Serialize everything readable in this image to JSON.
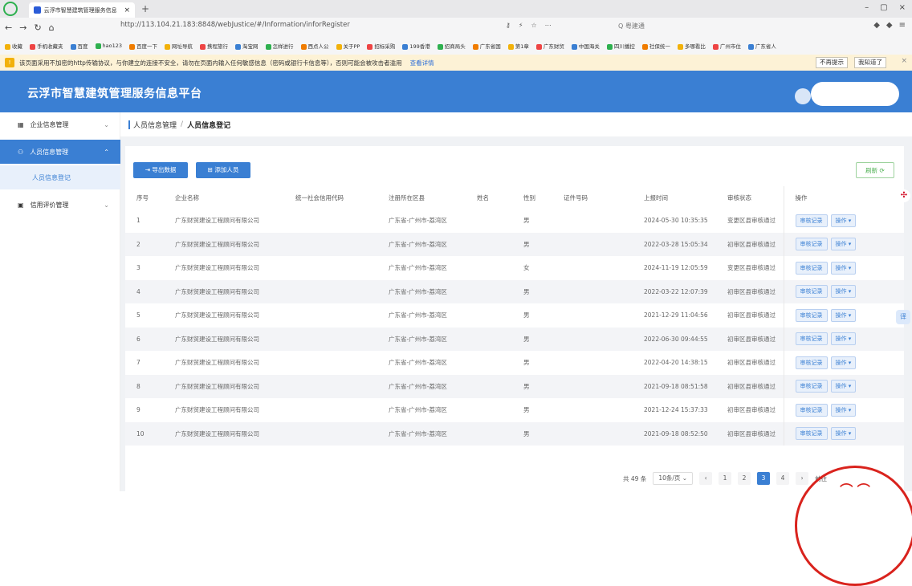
{
  "browser": {
    "tab_title": "云浮市智慧建筑管理服务信息",
    "url": "http://113.104.21.183:8848/webJustice/#/Information/inforRegister",
    "search_placeholder": "Q 粤建通",
    "bookmarks": [
      "收藏",
      "手机收藏夹",
      "百度",
      "hao123",
      "百度一下",
      "网址导航",
      "携程旅行",
      "淘宝网",
      "怎样进行",
      "西点人公",
      "关于PP",
      "招标采购",
      "199香港",
      "招商局头",
      "广东省国",
      "第1章",
      "广东财贸",
      "中国海关",
      "四川播控",
      "社保统一",
      "多哪看比",
      "广州市住",
      "广东省人"
    ]
  },
  "warning": {
    "text": "该页面采用不加密的http传输协议，与你建立的连接不安全，请勿在页面内输入任何敏感信息（密码或银行卡信息等），否则可能会被攻击者滥用",
    "link": "查看详情",
    "btn_no_remind": "不再提示",
    "btn_ok": "我知道了"
  },
  "header": {
    "title": "云浮市智慧建筑管理服务信息平台"
  },
  "sidebar": {
    "items": [
      {
        "label": "企业信息管理"
      },
      {
        "label": "人员信息管理"
      },
      {
        "label": "人员信息登记"
      },
      {
        "label": "信用评价管理"
      }
    ]
  },
  "breadcrumb": {
    "parent": "人员信息管理",
    "sep": "/",
    "current": "人员信息登记"
  },
  "toolbar": {
    "export": "导出数据",
    "add": "添加人员",
    "refresh": "刷新"
  },
  "table": {
    "headers": [
      "序号",
      "企业名称",
      "统一社会信用代码",
      "注册所在区县",
      "姓名",
      "性别",
      "证件号码",
      "上报时间",
      "审核状态",
      "操作"
    ],
    "rows": [
      {
        "no": "1",
        "company": "广东财贸建设工程顾问有限公司",
        "region": "广东省-广州市-荔湾区",
        "gender": "男",
        "time": "2024-05-30 10:35:35",
        "status": "变更区县审核通过"
      },
      {
        "no": "2",
        "company": "广东财贸建设工程顾问有限公司",
        "region": "广东省-广州市-荔湾区",
        "gender": "男",
        "time": "2022-03-28 15:05:34",
        "status": "初审区县审核通过"
      },
      {
        "no": "3",
        "company": "广东财贸建设工程顾问有限公司",
        "region": "广东省-广州市-荔湾区",
        "gender": "女",
        "time": "2024-11-19 12:05:59",
        "status": "变更区县审核通过"
      },
      {
        "no": "4",
        "company": "广东财贸建设工程顾问有限公司",
        "region": "广东省-广州市-荔湾区",
        "gender": "男",
        "time": "2022-03-22 12:07:39",
        "status": "初审区县审核通过"
      },
      {
        "no": "5",
        "company": "广东财贸建设工程顾问有限公司",
        "region": "广东省-广州市-荔湾区",
        "gender": "男",
        "time": "2021-12-29 11:04:56",
        "status": "初审区县审核通过"
      },
      {
        "no": "6",
        "company": "广东财贸建设工程顾问有限公司",
        "region": "广东省-广州市-荔湾区",
        "gender": "男",
        "time": "2022-06-30 09:44:55",
        "status": "初审区县审核通过"
      },
      {
        "no": "7",
        "company": "广东财贸建设工程顾问有限公司",
        "region": "广东省-广州市-荔湾区",
        "gender": "男",
        "time": "2022-04-20 14:38:15",
        "status": "初审区县审核通过"
      },
      {
        "no": "8",
        "company": "广东财贸建设工程顾问有限公司",
        "region": "广东省-广州市-荔湾区",
        "gender": "男",
        "time": "2021-09-18 08:51:58",
        "status": "初审区县审核通过"
      },
      {
        "no": "9",
        "company": "广东财贸建设工程顾问有限公司",
        "region": "广东省-广州市-荔湾区",
        "gender": "男",
        "time": "2021-12-24 15:37:33",
        "status": "初审区县审核通过"
      },
      {
        "no": "10",
        "company": "广东财贸建设工程顾问有限公司",
        "region": "广东省-广州市-荔湾区",
        "gender": "男",
        "time": "2021-09-18 08:52:50",
        "status": "初审区县审核通过"
      }
    ],
    "action_review": "审核记录",
    "action_ops": "操作"
  },
  "pager": {
    "total": "共 49 条",
    "size": "10条/页",
    "pages": [
      "1",
      "2",
      "3",
      "4"
    ],
    "current": "3",
    "goto": "前往"
  },
  "colors": {
    "primary": "#3a7fd3",
    "warn_bg": "#fdf2d6",
    "stripe": "#f3f4f7"
  }
}
